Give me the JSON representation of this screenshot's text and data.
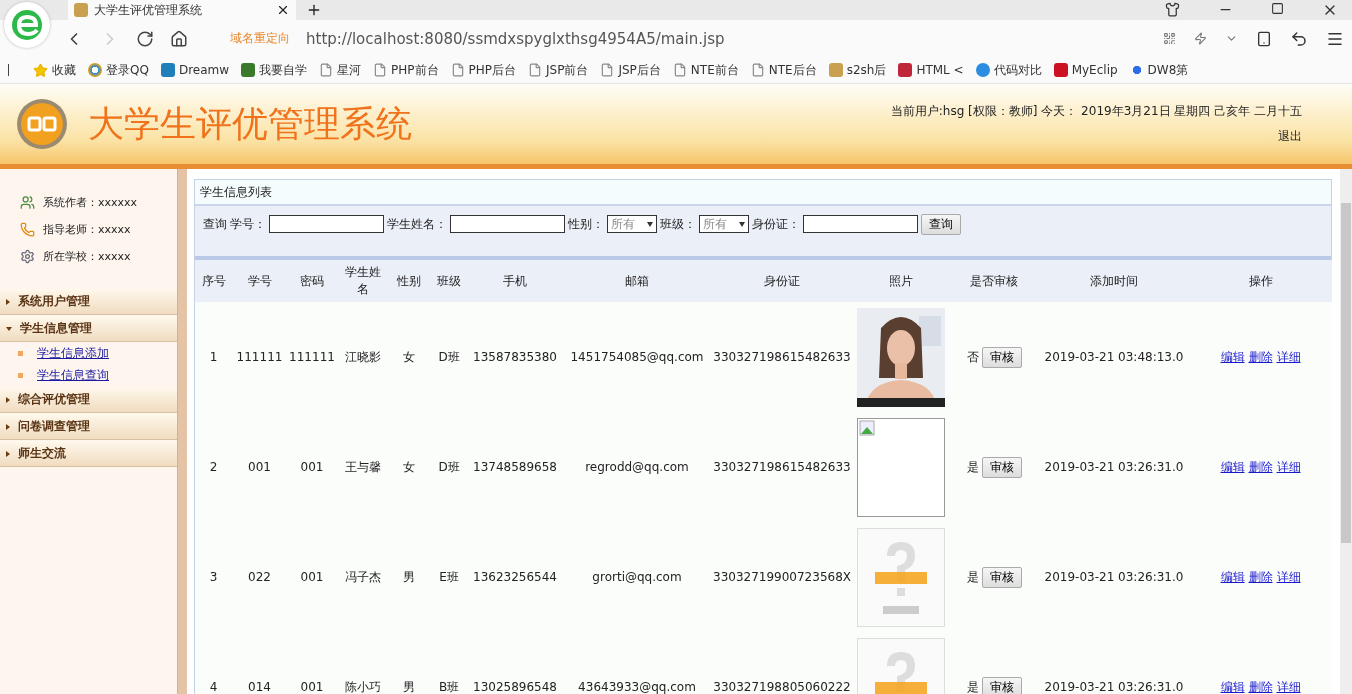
{
  "browser": {
    "tab_title": "大学生评优管理系统",
    "redirect_label": "域名重定向",
    "url": "http://localhost:8080/ssmdxspyglxthsg4954A5/main.jsp",
    "bookmarks": [
      {
        "label": "收藏",
        "kind": "star"
      },
      {
        "label": "登录QQ",
        "kind": "qq"
      },
      {
        "label": "Dreamw",
        "kind": "dw"
      },
      {
        "label": "我要自学",
        "kind": "v"
      },
      {
        "label": "星河",
        "kind": "page"
      },
      {
        "label": "PHP前台",
        "kind": "page"
      },
      {
        "label": "PHP后台",
        "kind": "page"
      },
      {
        "label": "JSP前台",
        "kind": "page"
      },
      {
        "label": "JSP后台",
        "kind": "page"
      },
      {
        "label": "NTE前台",
        "kind": "page"
      },
      {
        "label": "NTE后台",
        "kind": "page"
      },
      {
        "label": "s2sh后",
        "kind": "img"
      },
      {
        "label": "HTML <",
        "kind": "h5"
      },
      {
        "label": "代码对比",
        "kind": "c"
      },
      {
        "label": "MyEclip",
        "kind": "me"
      },
      {
        "label": "DW8第",
        "kind": "paw"
      }
    ]
  },
  "header": {
    "title": "大学生评优管理系统",
    "user_info": "当前用户:hsg [权限：教师] 今天： 2019年3月21日 星期四 己亥年 二月十五",
    "logout": "退出"
  },
  "sidebar": {
    "info": [
      {
        "label": "系统作者：xxxxxx",
        "kind": "users"
      },
      {
        "label": "指导老师：xxxxx",
        "kind": "phone"
      },
      {
        "label": "所在学校：xxxxx",
        "kind": "gear"
      }
    ],
    "menu": [
      {
        "label": "系统用户管理",
        "expanded": false
      },
      {
        "label": "学生信息管理",
        "expanded": true,
        "children": [
          {
            "label": "学生信息添加"
          },
          {
            "label": "学生信息查询"
          }
        ]
      },
      {
        "label": "综合评优管理",
        "expanded": false
      },
      {
        "label": "问卷调查管理",
        "expanded": false
      },
      {
        "label": "师生交流",
        "expanded": false
      }
    ]
  },
  "panel": {
    "title": "学生信息列表",
    "search": {
      "label": "查询",
      "fields": [
        {
          "kind": "input",
          "label": "学号："
        },
        {
          "kind": "input",
          "label": "学生姓名："
        },
        {
          "kind": "select",
          "label": "性别：",
          "value": "所有"
        },
        {
          "kind": "select",
          "label": "班级：",
          "value": "所有"
        },
        {
          "kind": "input",
          "label": "身份证："
        }
      ],
      "button": "查询"
    }
  },
  "table": {
    "columns": [
      "序号",
      "学号",
      "密码",
      "学生姓名",
      "性别",
      "班级",
      "手机",
      "邮箱",
      "身份证",
      "照片",
      "是否审核",
      "添加时间",
      "操作"
    ],
    "rows": [
      {
        "cells": [
          "1",
          "111111",
          "111111",
          "江晓影",
          "女",
          "D班",
          "13587835380",
          "1451754085@qq.com",
          "330327198615482633"
        ],
        "photo": {
          "kind": "picture"
        },
        "audited": "否",
        "audit_button": "审核",
        "added": "2019-03-21 03:48:13.0",
        "actions": [
          "编辑",
          "删除",
          "详细"
        ]
      },
      {
        "cells": [
          "2",
          "001",
          "001",
          "王与馨",
          "女",
          "D班",
          "13748589658",
          "regrodd@qq.com",
          "330327198615482633"
        ],
        "photo": {
          "kind": "broken"
        },
        "audited": "是",
        "audit_button": "审核",
        "added": "2019-03-21 03:26:31.0",
        "actions": [
          "编辑",
          "删除",
          "详细"
        ]
      },
      {
        "cells": [
          "3",
          "022",
          "001",
          "冯子杰",
          "男",
          "E班",
          "13623256544",
          "grorti@qq.com",
          "33032719900723568X"
        ],
        "photo": {
          "kind": "nopic"
        },
        "audited": "是",
        "audit_button": "审核",
        "added": "2019-03-21 03:26:31.0",
        "actions": [
          "编辑",
          "删除",
          "详细"
        ]
      },
      {
        "cells": [
          "4",
          "014",
          "001",
          "陈小巧",
          "男",
          "B班",
          "13025896548",
          "43643933@qq.com",
          "330327198805060222"
        ],
        "photo": {
          "kind": "nopic"
        },
        "audited": "是",
        "audit_button": "审核",
        "added": "2019-03-21 03:26:31.0",
        "actions": [
          "编辑",
          "删除",
          "详细"
        ]
      }
    ]
  }
}
